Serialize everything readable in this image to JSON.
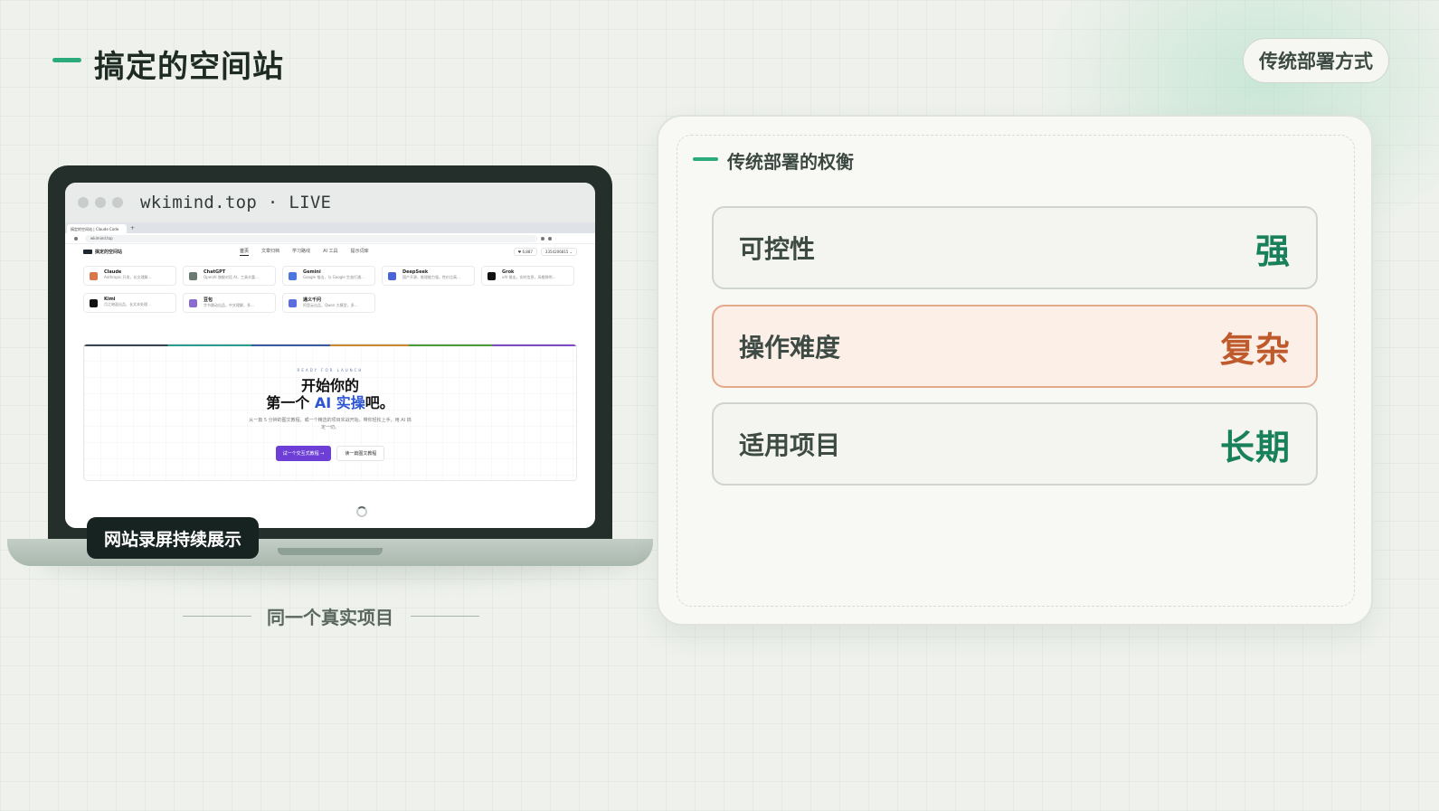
{
  "header": {
    "title": "搞定的空间站",
    "pill_label": "传统部署方式"
  },
  "laptop": {
    "window_url": "wkimind.top · LIVE",
    "browser": {
      "tab_title": "搞定的空间站 | Claude Code",
      "tab_plus": "+",
      "address": "wkimind.top",
      "site_brand": "搞定的空间站",
      "nav_links": [
        "首页",
        "文章归档",
        "学习路线",
        "AI 工具",
        "提示词库"
      ],
      "nav_right": [
        "♥ 6,887",
        "3354206815 ⌄"
      ],
      "models": [
        {
          "name": "Claude",
          "desc": "Anthropic 开发，长文理解…",
          "color": "#d9774b"
        },
        {
          "name": "ChatGPT",
          "desc": "OpenAI 旗舰对话 AI，工具丰富…",
          "color": "#6b7a73"
        },
        {
          "name": "Gemini",
          "desc": "Google 推出，与 Google 生态打通…",
          "color": "#4a78e0"
        },
        {
          "name": "DeepSeek",
          "desc": "国产开源，推理能力强，性价比高…",
          "color": "#4b63d6"
        },
        {
          "name": "Grok",
          "desc": "xAI 推出，实时信息，风格鲜明…",
          "color": "#111111"
        },
        {
          "name": "Kimi",
          "desc": "月之暗面出品，长文本处理…",
          "color": "#111111"
        },
        {
          "name": "豆包",
          "desc": "字节跳动出品，中文理解，多…",
          "color": "#8a6bd0"
        },
        {
          "name": "通义千问",
          "desc": "阿里云出品，Qwen 大模型，多…",
          "color": "#5b6ee0"
        }
      ],
      "hero": {
        "kicker": "READY FOR LAUNCH",
        "line1": "开始你的",
        "line2_pre": "第一个 ",
        "line2_ai": "AI 实操",
        "line2_post": "吧。",
        "sub": "从一篇 5 分钟的图文教程，或一个精选的项目实战开始，带你轻松上手，用 AI 搞定一切。",
        "btn_primary": "试一个交互式教程 →",
        "btn_secondary": "读一篇图文教程"
      }
    },
    "badge": "网站录屏持续展示",
    "caption": "同一个真实项目"
  },
  "panel": {
    "title": "传统部署的权衡",
    "rows": [
      {
        "label": "可控性",
        "value": "强"
      },
      {
        "label": "操作难度",
        "value": "复杂"
      },
      {
        "label": "适用项目",
        "value": "长期"
      }
    ]
  },
  "colors": {
    "accent": "#2bab7d",
    "good": "#18805b",
    "warn": "#bf5a2c"
  }
}
